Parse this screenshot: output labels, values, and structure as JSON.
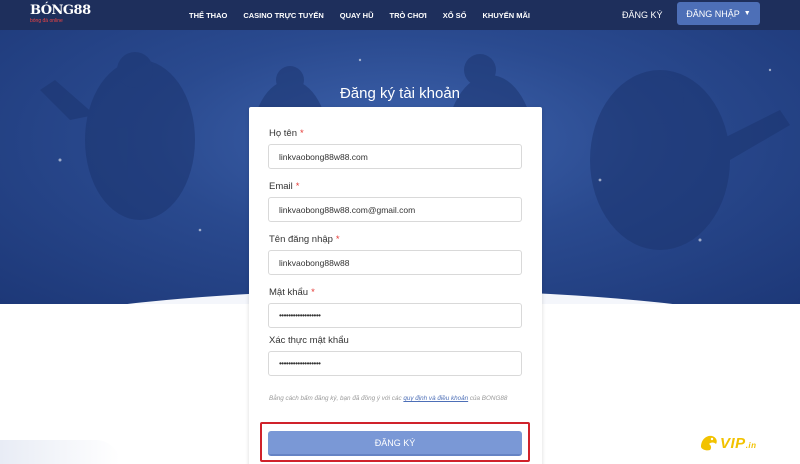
{
  "brand": {
    "logo_text": "BÓNG88",
    "logo_tagline": "bóng đá online"
  },
  "nav": {
    "items": [
      "THỂ THAO",
      "CASINO TRỰC TUYẾN",
      "QUAY HŨ",
      "TRÒ CHƠI",
      "XỔ SỐ",
      "KHUYẾN MÃI"
    ],
    "register_label": "ĐĂNG KÝ",
    "login_label": "ĐĂNG NHẬP"
  },
  "page": {
    "title": "Đăng ký tài khoản"
  },
  "form": {
    "fullname": {
      "label": "Họ tên",
      "required": "*",
      "value": "linkvaobong88w88.com"
    },
    "email": {
      "label": "Email",
      "required": "*",
      "value": "linkvaobong88w88.com@gmail.com"
    },
    "username": {
      "label": "Tên đăng nhập",
      "required": "*",
      "value": "linkvaobong88w88"
    },
    "password": {
      "label": "Mật khẩu",
      "required": "*",
      "value": "••••••••••••••••••"
    },
    "confirm": {
      "label": "Xác thực mật khẩu",
      "value": "••••••••••••••••••"
    },
    "terms_prefix": "Bằng cách bấm đăng ký, bạn đã đồng ý với các ",
    "terms_link": "quy định và điều khoản",
    "terms_suffix": " của BONG88",
    "submit_label": "ĐĂNG KÝ"
  },
  "watermark": {
    "text": "VIP",
    "suffix": ".in"
  },
  "colors": {
    "header_bg": "#1e2f5c",
    "accent": "#4d6fb7",
    "submit_bg": "#7a98d6",
    "highlight": "#d0222b",
    "required": "#e53935"
  }
}
